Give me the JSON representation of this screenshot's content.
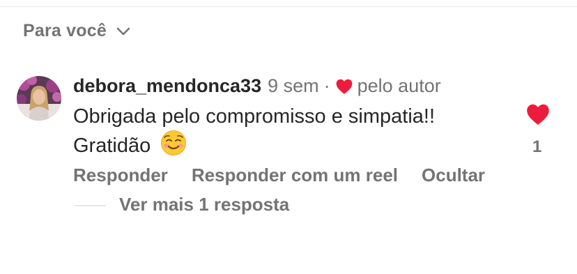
{
  "header": {
    "sort_label": "Para você",
    "sort_icon": "chevron-down-icon"
  },
  "comment": {
    "username": "debora_mendonca33",
    "time": "9 sem",
    "separator": "·",
    "liked_by_author_icon": "heart-filled-icon",
    "liked_by_author_label": "pelo autor",
    "text_line1": "Obrigada pelo compromisso e simpatia!!",
    "text_line2": "Gratidão",
    "emoji": "smiling-face-icon",
    "like_icon": "heart-filled-icon",
    "like_count": "1",
    "actions": {
      "reply": "Responder",
      "reply_with_reel": "Responder com um reel",
      "hide": "Ocultar"
    },
    "view_replies": "Ver mais 1 resposta"
  },
  "colors": {
    "heart": "#ed1c3c",
    "secondary_text": "#737373",
    "primary_text": "#262626"
  }
}
